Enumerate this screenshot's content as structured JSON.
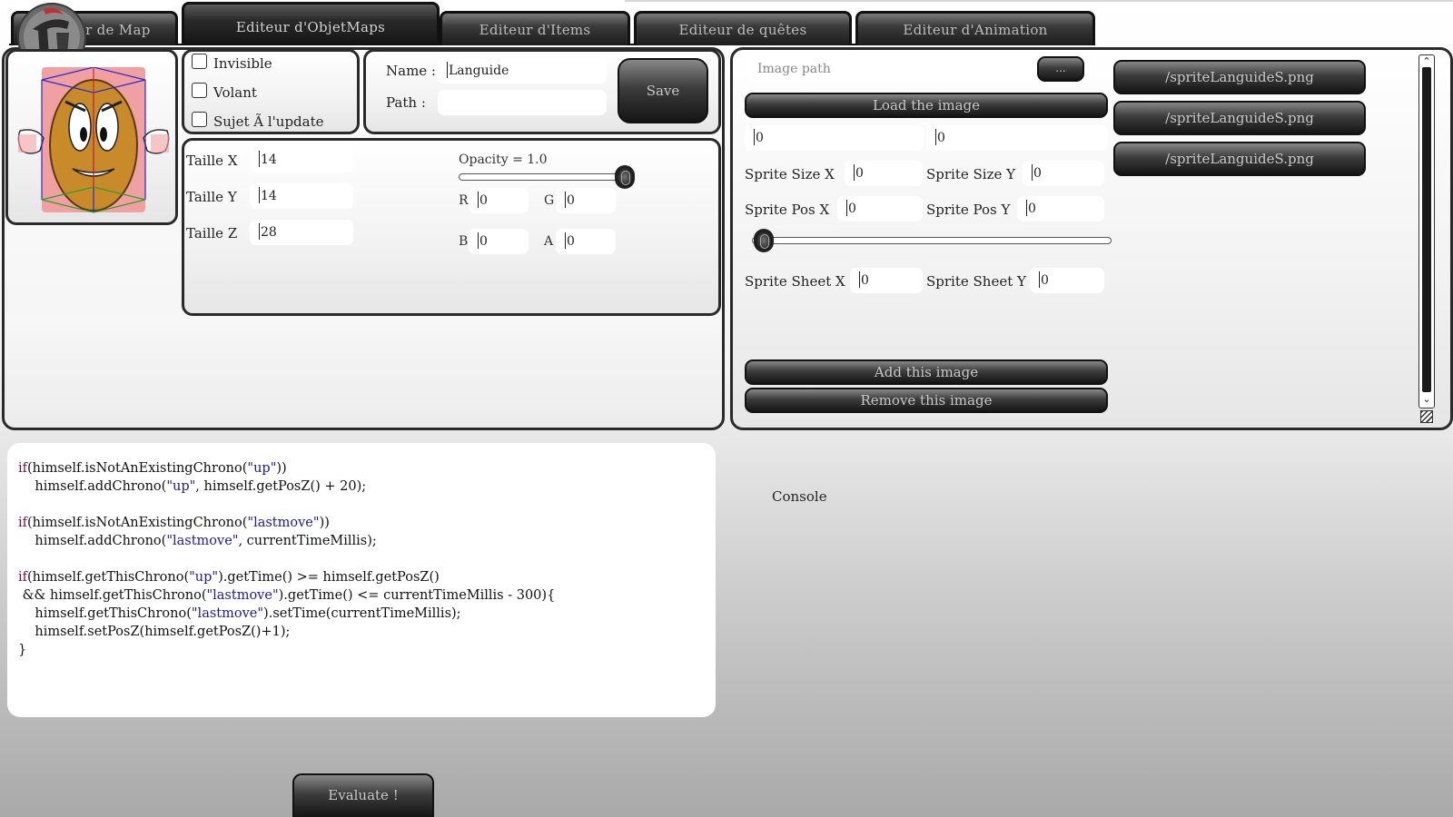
{
  "tabs": [
    {
      "label": "Editeur de Map"
    },
    {
      "label": "Editeur d'ObjetMaps"
    },
    {
      "label": "Editeur d'Items"
    },
    {
      "label": "Editeur de quêtes"
    },
    {
      "label": "Editeur d'Animation"
    }
  ],
  "object": {
    "checkboxes": [
      "Invisible",
      "Volant",
      "Sujet Ã  l'update"
    ],
    "name_label": "Name :",
    "name_value": "Languide",
    "path_label": "Path :",
    "path_value": "",
    "save_label": "Save",
    "taille_x_label": "Taille X",
    "taille_x": "14",
    "taille_y_label": "Taille Y",
    "taille_y": "14",
    "taille_z_label": "Taille Z",
    "taille_z": "28",
    "opacity_label": "Opacity = 1.0",
    "opacity_value": 1.0,
    "r_label": "R",
    "r": "0",
    "g_label": "G",
    "g": "0",
    "b_label": "B",
    "b": "0",
    "a_label": "A",
    "a": "0"
  },
  "sprite": {
    "image_path_placeholder": "Image path",
    "browse_label": "...",
    "load_label": "Load the image",
    "field1": "0",
    "field2": "0",
    "size_x_label": "Sprite Size X",
    "size_x": "0",
    "size_y_label": "Sprite Size Y",
    "size_y": "0",
    "pos_x_label": "Sprite Pos X",
    "pos_x": "0",
    "pos_y_label": "Sprite Pos Y",
    "pos_y": "0",
    "slider_value": 0,
    "sheet_x_label": "Sprite Sheet X",
    "sheet_x": "0",
    "sheet_y_label": "Sprite Sheet Y",
    "sheet_y": "0",
    "add_label": "Add this image",
    "remove_label": "Remove this image",
    "images": [
      "/spriteLanguideS.png",
      "/spriteLanguideS.png",
      "/spriteLanguideS.png"
    ]
  },
  "code": {
    "lines": [
      [
        [
          "kw",
          "if"
        ],
        [
          "t",
          "(himself.isNotAnExistingChrono("
        ],
        [
          "str",
          "\"up\""
        ],
        [
          "t",
          "))"
        ]
      ],
      [
        [
          "t",
          "    himself.addChrono("
        ],
        [
          "str",
          "\"up\""
        ],
        [
          "t",
          ", himself.getPosZ() + 20);"
        ]
      ],
      [
        [
          "t",
          ""
        ]
      ],
      [
        [
          "kw",
          "if"
        ],
        [
          "t",
          "(himself.isNotAnExistingChrono("
        ],
        [
          "str",
          "\"lastmove\""
        ],
        [
          "t",
          "))"
        ]
      ],
      [
        [
          "t",
          "    himself.addChrono("
        ],
        [
          "str",
          "\"lastmove\""
        ],
        [
          "t",
          ", currentTimeMillis);"
        ]
      ],
      [
        [
          "t",
          ""
        ]
      ],
      [
        [
          "kw",
          "if"
        ],
        [
          "t",
          "(himself.getThisChrono("
        ],
        [
          "str",
          "\"up\""
        ],
        [
          "t",
          ").getTime() >= himself.getPosZ()"
        ]
      ],
      [
        [
          "t",
          " && himself.getThisChrono("
        ],
        [
          "str",
          "\"lastmove\""
        ],
        [
          "t",
          ").getTime() <= currentTimeMillis - 300){"
        ]
      ],
      [
        [
          "t",
          "    himself.getThisChrono("
        ],
        [
          "str",
          "\"lastmove\""
        ],
        [
          "t",
          ").setTime(currentTimeMillis);"
        ]
      ],
      [
        [
          "t",
          "    himself.setPosZ(himself.getPosZ()+1);"
        ]
      ],
      [
        [
          "t",
          "}"
        ]
      ]
    ]
  },
  "console_label": "Console",
  "evaluate_label": "Evaluate !"
}
